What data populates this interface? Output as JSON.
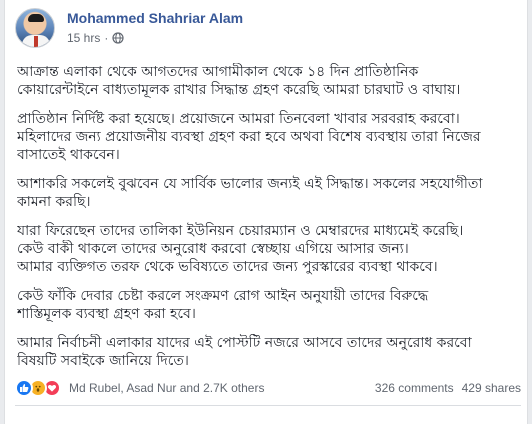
{
  "post": {
    "author": "Mohammed Shahriar Alam",
    "timestamp": "15 hrs",
    "separator": "·",
    "privacy_icon": "globe-icon",
    "paragraphs": [
      [
        "আক্রান্ত এলাকা থেকে আগতদের আগামীকাল থেকে ১৪ দিন প্রাতিষ্ঠানিক",
        "কোয়ারেন্টাইনে বাধ্যতামূলক রাখার সিদ্ধান্ত গ্রহণ করেছি আমরা চারঘাট ও বাঘায়।"
      ],
      [
        "প্রাতিষ্ঠান নির্দিষ্ট করা হয়েছে। প্রয়োজনে আমরা তিনবেলা খাবার সরবরাহ করবো।",
        "মহিলাদের জন্য প্রয়োজনীয় ব্যবস্থা গ্রহণ করা হবে অথবা বিশেষ ব্যবস্থায় তারা নিজের",
        "বাসাতেই থাকবেন।"
      ],
      [
        "আশাকরি সকলেই বুঝবেন যে সার্বিক ভালোর জন্যই এই সিদ্ধান্ত। সকলের সহযোগীতা",
        "কামনা করছি।"
      ],
      [
        "যারা ফিরেছেন তাদের তালিকা ইউনিয়ন চেয়ারম্যান ও মেম্বারদের মাধ্যমেই করেছি।",
        "কেউ বাকী থাকলে তাদের অনুরোধ করবো স্বেচ্ছায় এগিয়ে আসার জন্য।",
        "আমার ব্যক্তিগত তরফ থেকে ভবিষ্যতে তাদের জন্য পুরস্কারের ব্যবস্থা থাকবে।"
      ],
      [
        "কেউ ফাঁকি দেবার চেষ্টা করলে সংক্রমণ রোগ আইন অনুযায়ী তাদের বিরুদ্ধে",
        "শাস্তিমূলক ব্যবস্থা গ্রহণ করা হবে।"
      ],
      [
        "আমার নির্বাচনী এলাকার যাদের এই পোস্টটি নজরে আসবে তাদের অনুরোধ করবো",
        "বিষয়টি সবাইকে জানিয়ে দিতে।"
      ]
    ]
  },
  "footer": {
    "reaction_icons": [
      "like-icon",
      "wow-icon",
      "love-icon"
    ],
    "reactors": "Md Rubel, Asad Nur and 2.7K others",
    "comments": "326 comments",
    "shares": "429 shares"
  },
  "colors": {
    "name_link": "#385898",
    "meta_text": "#616770",
    "body_text": "#1d2129",
    "like_blue": "#1877f2",
    "wow_yellow": "#f7b125",
    "love_red": "#f33e58"
  }
}
